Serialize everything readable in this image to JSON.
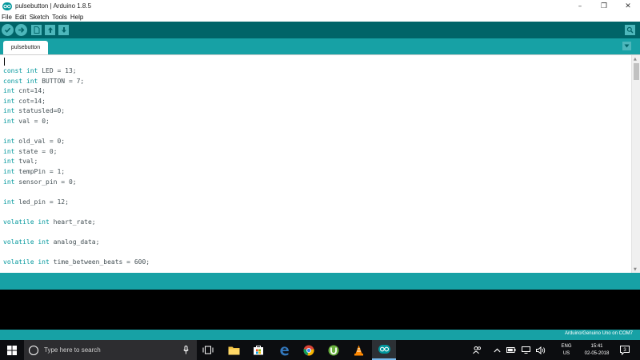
{
  "window": {
    "title": "pulsebutton | Arduino 1.8.5",
    "controls": [
      "–",
      "❐",
      "✕"
    ]
  },
  "menu": [
    "File",
    "Edit",
    "Sketch",
    "Tools",
    "Help"
  ],
  "toolbar": {
    "buttons": [
      "verify-icon",
      "upload-icon",
      "new-icon",
      "open-icon",
      "save-icon"
    ],
    "serial_monitor_icon": "serial-monitor-icon"
  },
  "tabs": {
    "active": "pulsebutton"
  },
  "editor": {
    "lines": [
      "const int LED = 13;",
      "const int BUTTON = 7;",
      "int cnt=14;",
      "int cot=14;",
      "int statusled=0;",
      "int val = 0;",
      "",
      "int old_val = 0;",
      "int state = 0;",
      "int tval;",
      "int tempPin = 1;",
      "int sensor_pin = 0;",
      "",
      "int led_pin = 12;",
      "",
      "volatile int heart_rate;",
      "",
      "volatile int analog_data;",
      "",
      "volatile int time_between_beats = 600;"
    ],
    "keywords": [
      "const",
      "int",
      "volatile"
    ]
  },
  "footer": {
    "board": "Arduino/Genuino Uno on COM7"
  },
  "taskbar": {
    "search_placeholder": "Type here to search",
    "apps": [
      "task-view-icon",
      "file-explorer-icon",
      "store-icon",
      "edge-icon",
      "chrome-icon",
      "utorrent-icon",
      "vlc-icon",
      "arduino-icon"
    ],
    "tray": {
      "lang_top": "ENG",
      "lang_bottom": "US",
      "time": "15:41",
      "date": "02-05-2018",
      "notification_count": "3"
    }
  },
  "colors": {
    "arduino_dark": "#006468",
    "arduino_teal": "#17a1a5",
    "arduino_button": "#4db7bb",
    "keyword": "#00979c",
    "code_text": "#434f54"
  }
}
